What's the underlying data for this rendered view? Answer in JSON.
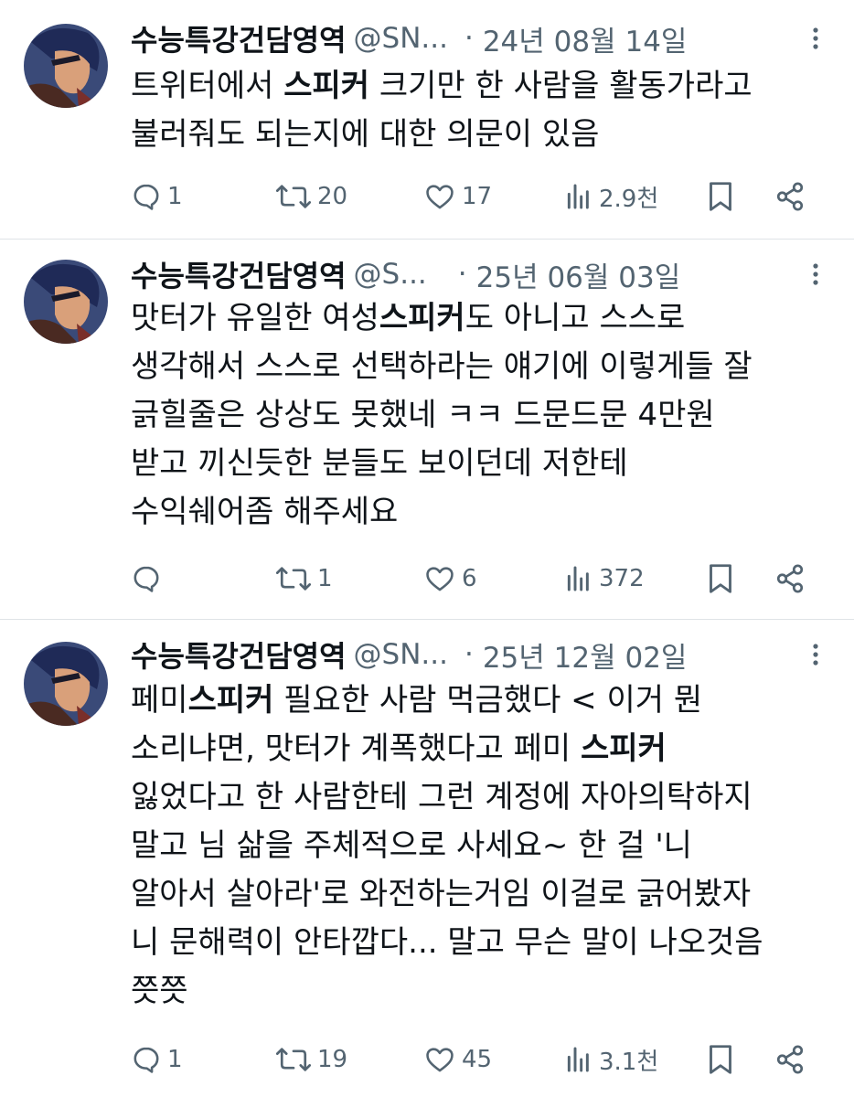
{
  "tweets": [
    {
      "name": "수능특강건담영역",
      "handle": "@SN...",
      "separator": "·",
      "date": "24년 08월 14일",
      "lines": [
        [
          {
            "t": "트위터에서 "
          },
          {
            "t": "스피커",
            "b": true
          },
          {
            "t": " 크기만 한 사람을 활동가라고"
          }
        ],
        [
          {
            "t": "불러줘도 되는지에 대한 의문이 있음"
          }
        ]
      ],
      "counts": {
        "replies": "1",
        "retweets": "20",
        "likes": "17",
        "views": "2.9천"
      }
    },
    {
      "name": "수능특강건담영역",
      "handle": "@S...",
      "separator": "·",
      "date": "25년 06월 03일",
      "lines": [
        [
          {
            "t": "맛터가 유일한 여성"
          },
          {
            "t": "스피커",
            "b": true
          },
          {
            "t": "도 아니고 스스로"
          }
        ],
        [
          {
            "t": "생각해서 스스로 선택하라는 얘기에 이렇게들 잘"
          }
        ],
        [
          {
            "t": "긁힐줄은 상상도 못했네 ㅋㅋ 드문드문 4만원"
          }
        ],
        [
          {
            "t": "받고 끼신듯한 분들도 보이던데 저한테"
          }
        ],
        [
          {
            "t": "수익쉐어좀 해주세요"
          }
        ]
      ],
      "counts": {
        "replies": "",
        "retweets": "1",
        "likes": "6",
        "views": "372"
      }
    },
    {
      "name": "수능특강건담영역",
      "handle": "@SN...",
      "separator": "·",
      "date": "25년 12월 02일",
      "lines": [
        [
          {
            "t": "페미"
          },
          {
            "t": "스피커",
            "b": true
          },
          {
            "t": " 필요한 사람 먹금했다 < 이거 뭔"
          }
        ],
        [
          {
            "t": "소리냐면, 맛터가 계폭했다고 페미 "
          },
          {
            "t": "스피커",
            "b": true
          }
        ],
        [
          {
            "t": "잃었다고 한 사람한테 그런 계정에 자아의탁하지"
          }
        ],
        [
          {
            "t": "말고 님 삶을 주체적으로 사세요~ 한 걸 '니"
          }
        ],
        [
          {
            "t": "알아서 살아라'로 와전하는거임 이걸로 긁어봤자"
          }
        ],
        [
          {
            "t": "니 문해력이 안타깝다... 말고 무슨 말이 나오것음"
          }
        ],
        [
          {
            "t": "쯧쯧"
          }
        ]
      ],
      "counts": {
        "replies": "1",
        "retweets": "19",
        "likes": "45",
        "views": "3.1천"
      }
    }
  ],
  "colors": {
    "text": "#0f1419",
    "muted": "#536471",
    "divider": "#dfe3e6"
  }
}
